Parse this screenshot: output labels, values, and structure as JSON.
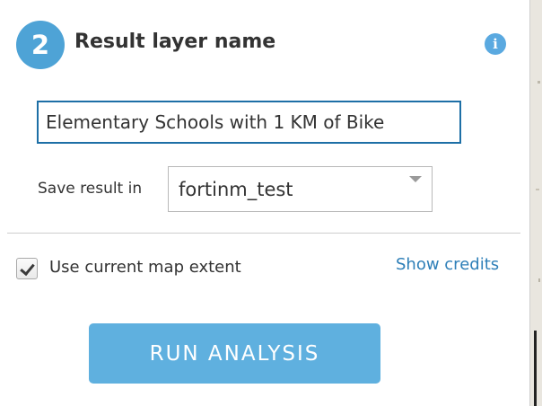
{
  "step": {
    "number": "2",
    "title": "Result layer name"
  },
  "info": {
    "icon": "info-icon",
    "glyph": "i",
    "color": "#5aa9e0"
  },
  "result_name": {
    "value": "Elementary Schools with 1 KM of Bike"
  },
  "save": {
    "label": "Save result in",
    "selected": "fortinm_test"
  },
  "extent": {
    "label": "Use current map extent",
    "checked": true
  },
  "credits": {
    "label": "Show credits"
  },
  "run": {
    "label": "RUN ANALYSIS",
    "color": "#5fb0df"
  },
  "colors": {
    "accent": "#4ea3d6",
    "link": "#2e7fb8",
    "input_border": "#1d6fa6"
  }
}
